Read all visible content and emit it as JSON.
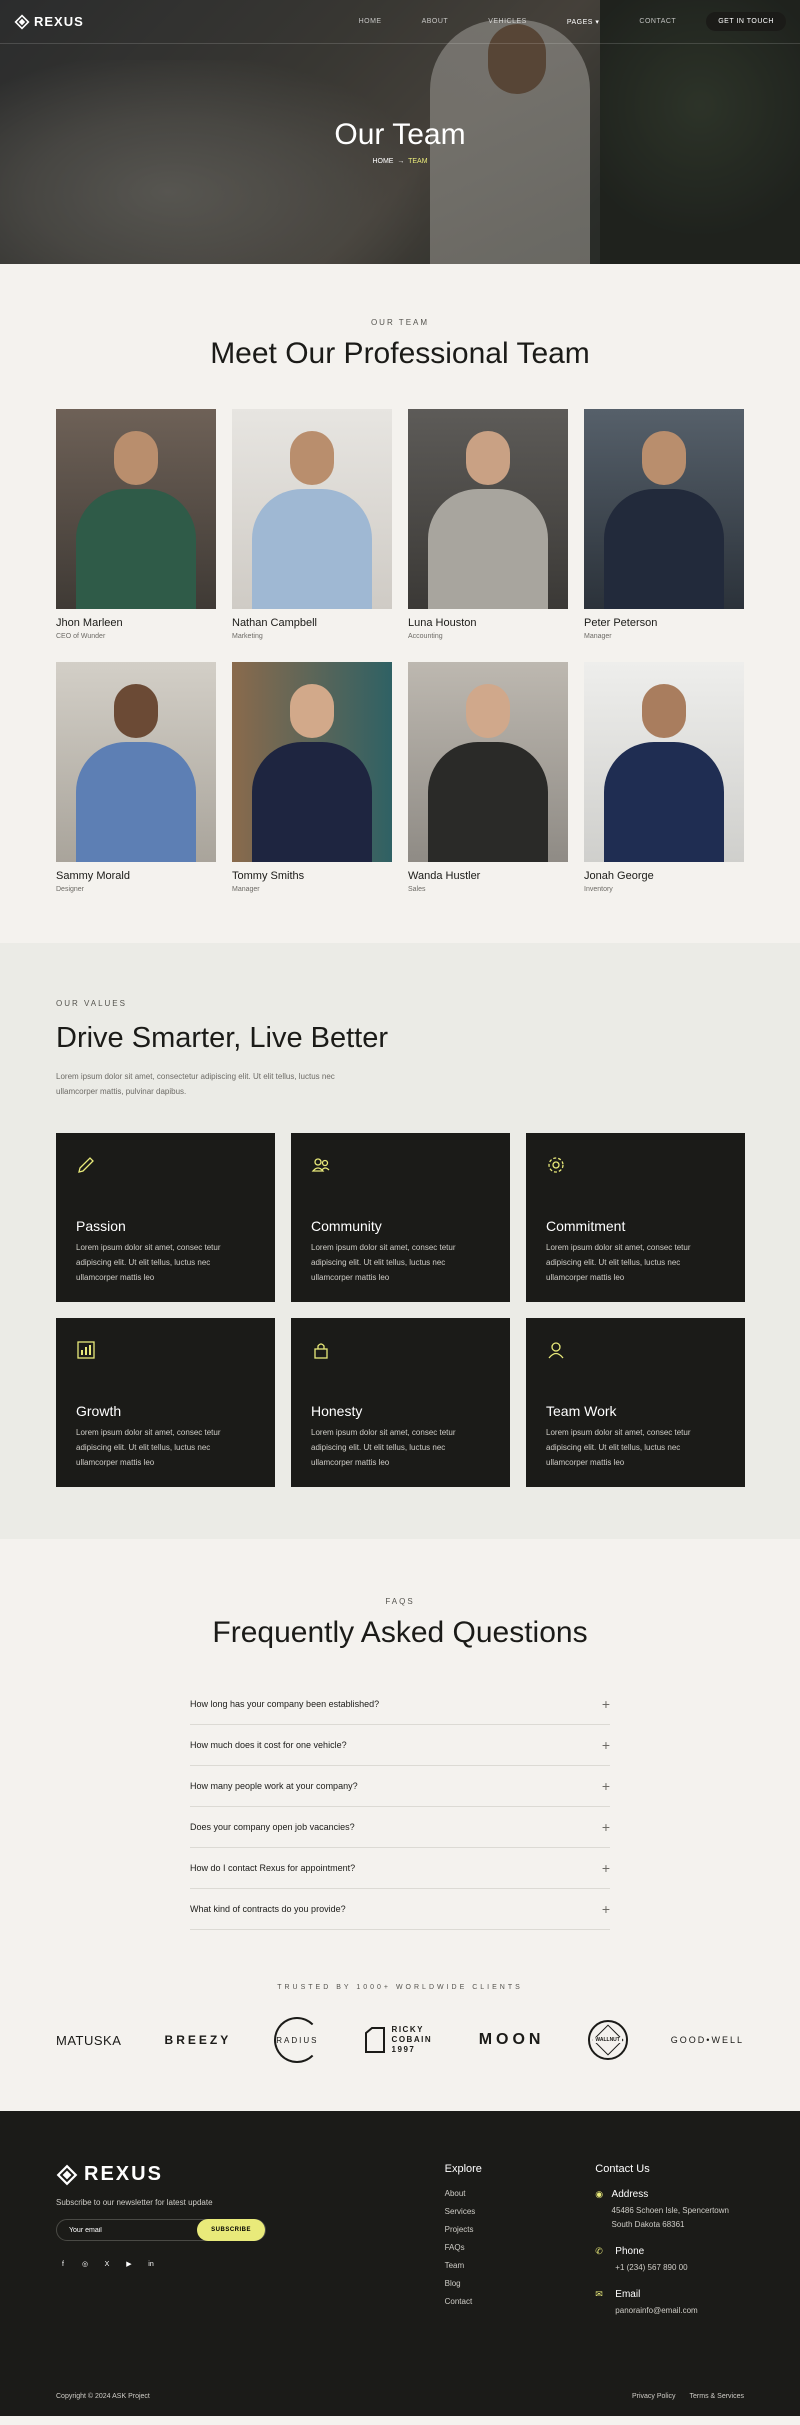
{
  "nav": {
    "brand": "REXUS",
    "links": [
      "HOME",
      "ABOUT",
      "VEHICLES",
      "PAGES",
      "CONTACT"
    ],
    "cta": "GET IN TOUCH"
  },
  "hero": {
    "title": "Our Team",
    "crumb_home": "HOME",
    "crumb_sep": "→",
    "crumb_current": "TEAM"
  },
  "team": {
    "eyebrow": "OUR TEAM",
    "title": "Meet Our Professional Team",
    "members": [
      {
        "name": "Jhon Marleen",
        "role": "CEO of Wunder"
      },
      {
        "name": "Nathan Campbell",
        "role": "Marketing"
      },
      {
        "name": "Luna Houston",
        "role": "Accounting"
      },
      {
        "name": "Peter Peterson",
        "role": "Manager"
      },
      {
        "name": "Sammy Morald",
        "role": "Designer"
      },
      {
        "name": "Tommy Smiths",
        "role": "Manager"
      },
      {
        "name": "Wanda Hustler",
        "role": "Sales"
      },
      {
        "name": "Jonah George",
        "role": "Inventory"
      }
    ]
  },
  "values": {
    "eyebrow": "OUR VALUES",
    "title": "Drive Smarter, Live Better",
    "lead": "Lorem ipsum dolor sit amet, consectetur adipiscing elit. Ut elit tellus, luctus nec ullamcorper mattis, pulvinar dapibus.",
    "cards": [
      {
        "title": "Passion",
        "text": "Lorem ipsum dolor sit amet, consec tetur adipiscing elit. Ut elit tellus, luctus nec ullamcorper mattis leo",
        "icon": "pencil-icon"
      },
      {
        "title": "Community",
        "text": "Lorem ipsum dolor sit amet, consec tetur adipiscing elit. Ut elit tellus, luctus nec ullamcorper mattis leo",
        "icon": "users-icon"
      },
      {
        "title": "Commitment",
        "text": "Lorem ipsum dolor sit amet, consec tetur adipiscing elit. Ut elit tellus, luctus nec ullamcorper mattis leo",
        "icon": "gear-icon"
      },
      {
        "title": "Growth",
        "text": "Lorem ipsum dolor sit amet, consec tetur adipiscing elit. Ut elit tellus, luctus nec ullamcorper mattis leo",
        "icon": "chart-icon"
      },
      {
        "title": "Honesty",
        "text": "Lorem ipsum dolor sit amet, consec tetur adipiscing elit. Ut elit tellus, luctus nec ullamcorper mattis leo",
        "icon": "lock-icon"
      },
      {
        "title": "Team Work",
        "text": "Lorem ipsum dolor sit amet, consec tetur adipiscing elit. Ut elit tellus, luctus nec ullamcorper mattis leo",
        "icon": "user-icon"
      }
    ]
  },
  "faq": {
    "eyebrow": "FAQS",
    "title": "Frequently Asked Questions",
    "items": [
      "How long has your company been established?",
      "How much does it cost for one vehicle?",
      "How many people work at your company?",
      "Does your company open job vacancies?",
      "How do I contact Rexus for appointment?",
      "What kind of contracts do you provide?"
    ]
  },
  "trusted": {
    "eyebrow": "TRUSTED BY 1000+ WORLDWIDE CLIENTS",
    "brands": [
      "MATUSKA",
      "BREEZY",
      "RADIUS",
      "RICKY COBAIN 1997",
      "MOON",
      "WALLNUT",
      "GOOD•WELL"
    ]
  },
  "footer": {
    "brand": "REXUS",
    "subscribe_text": "Subscribe to our newsletter for latest update",
    "email_placeholder": "Your email",
    "subscribe_button": "SUBSCRIBE",
    "socials": [
      "f",
      "◎",
      "X",
      "▶",
      "in"
    ],
    "explore_title": "Explore",
    "explore_links": [
      "About",
      "Services",
      "Projects",
      "FAQs",
      "Team",
      "Blog",
      "Contact"
    ],
    "contact_title": "Contact Us",
    "address_label": "Address",
    "address_value": "45486 Schoen Isle, Spencertown South Dakota 68361",
    "phone_label": "Phone",
    "phone_value": "+1 (234) 567 890 00",
    "email_label": "Email",
    "email_value": "panorainfo@email.com",
    "copyright": "Copyright © 2024 ASK Project",
    "privacy": "Privacy Policy",
    "terms": "Terms & Services"
  },
  "colors": {
    "accent": "#e9ea7a",
    "dark": "#1b1b18",
    "bg": "#f4f2ee",
    "values_bg": "#ebebe6"
  }
}
